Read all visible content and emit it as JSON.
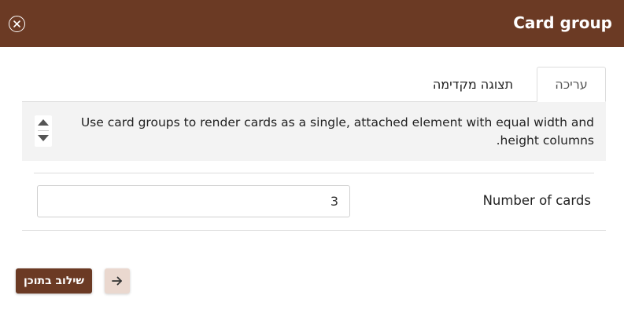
{
  "dialog": {
    "title": "Card group"
  },
  "tabs": {
    "edit_label": "עריכה",
    "preview_label": "תצוגה מקדימה"
  },
  "description": {
    "text": "Use card groups to render cards as a single, attached element with equal width and height columns."
  },
  "fields": {
    "number_of_cards": {
      "label": "Number of cards",
      "value": "3"
    }
  },
  "footer": {
    "insert_label": "שילוב בתוכן"
  },
  "icons": {
    "close": "close-circle-icon",
    "scroll_up": "arrow-up-icon",
    "scroll_down": "arrow-down-icon",
    "next": "arrow-right-icon"
  },
  "colors": {
    "brand": "#6b3a24",
    "next_button_bg": "#ead8cf",
    "description_bg": "#f3f3f3"
  }
}
